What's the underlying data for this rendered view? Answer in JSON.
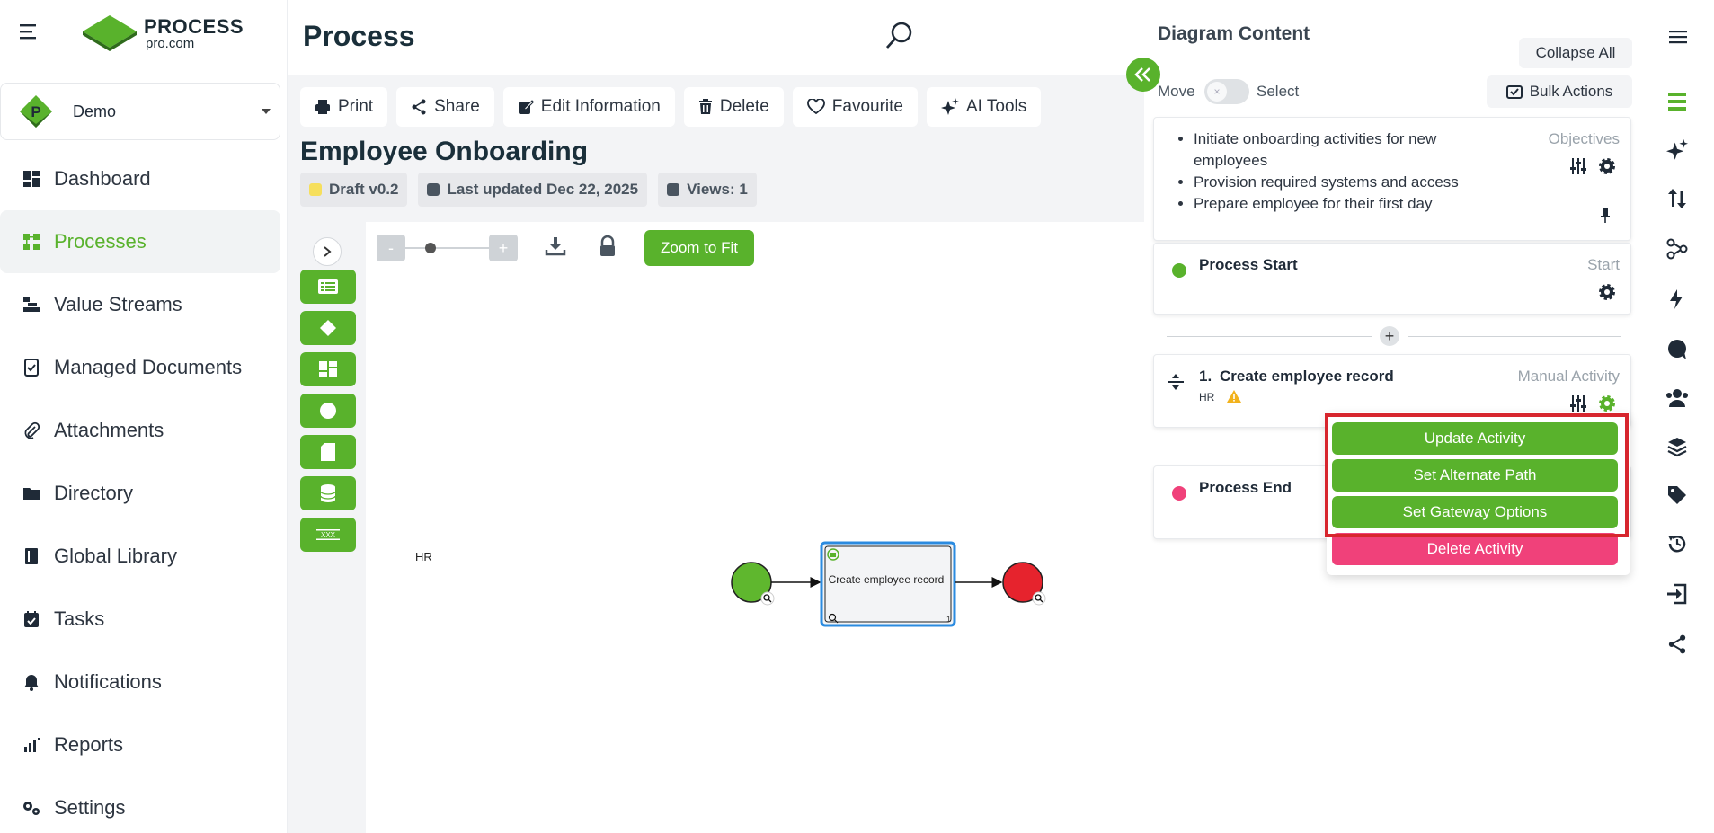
{
  "app": {
    "logo_title": "PROCESS",
    "logo_sub": "pro.com",
    "org_name": "Demo",
    "org_badge": "P",
    "brand_color": "#59b22c"
  },
  "sidebar": {
    "items": [
      {
        "label": "Dashboard",
        "icon": "dashboard-icon",
        "active": false
      },
      {
        "label": "Processes",
        "icon": "processes-icon",
        "active": true
      },
      {
        "label": "Value Streams",
        "icon": "value-streams-icon",
        "active": false
      },
      {
        "label": "Managed Documents",
        "icon": "managed-documents-icon",
        "active": false
      },
      {
        "label": "Attachments",
        "icon": "paperclip-icon",
        "active": false
      },
      {
        "label": "Directory",
        "icon": "folder-icon",
        "active": false
      },
      {
        "label": "Global Library",
        "icon": "book-icon",
        "active": false
      },
      {
        "label": "Tasks",
        "icon": "calendar-check-icon",
        "active": false
      },
      {
        "label": "Notifications",
        "icon": "bell-icon",
        "active": false
      },
      {
        "label": "Reports",
        "icon": "bar-chart-icon",
        "active": false
      },
      {
        "label": "Settings",
        "icon": "gears-icon",
        "active": false
      }
    ]
  },
  "header": {
    "title": "Process"
  },
  "toolbar": {
    "print": "Print",
    "share": "Share",
    "edit": "Edit Information",
    "delete": "Delete",
    "favourite": "Favourite",
    "ai_tools": "AI Tools"
  },
  "document": {
    "title": "Employee Onboarding",
    "status": "Draft v0.2",
    "updated": "Last updated Dec 22, 2025",
    "views": "Views: 1"
  },
  "canvas": {
    "zoom_minus": "-",
    "zoom_plus": "+",
    "zoom_level": 0.5,
    "zoom_to_fit": "Zoom to Fit",
    "lane_label": "HR",
    "task_label": "Create employee record",
    "task_counter": "1"
  },
  "panel": {
    "title": "Diagram Content",
    "collapse_all": "Collapse All",
    "move_label": "Move",
    "select_label": "Select",
    "toggle_mark": "×",
    "bulk_actions": "Bulk Actions",
    "objectives": {
      "type": "Objectives",
      "items": [
        "Initiate onboarding activities for new employees",
        "Provision required systems and access",
        "Prepare employee for their first day"
      ]
    },
    "start": {
      "name": "Process Start",
      "type": "Start"
    },
    "activity": {
      "number": "1.",
      "name": "Create employee record",
      "lane": "HR",
      "type": "Manual Activity"
    },
    "end": {
      "name": "Process End"
    },
    "add_symbol": "+",
    "menu": {
      "update": "Update Activity",
      "alternate": "Set Alternate Path",
      "gateway": "Set Gateway Options",
      "delete": "Delete Activity"
    }
  }
}
